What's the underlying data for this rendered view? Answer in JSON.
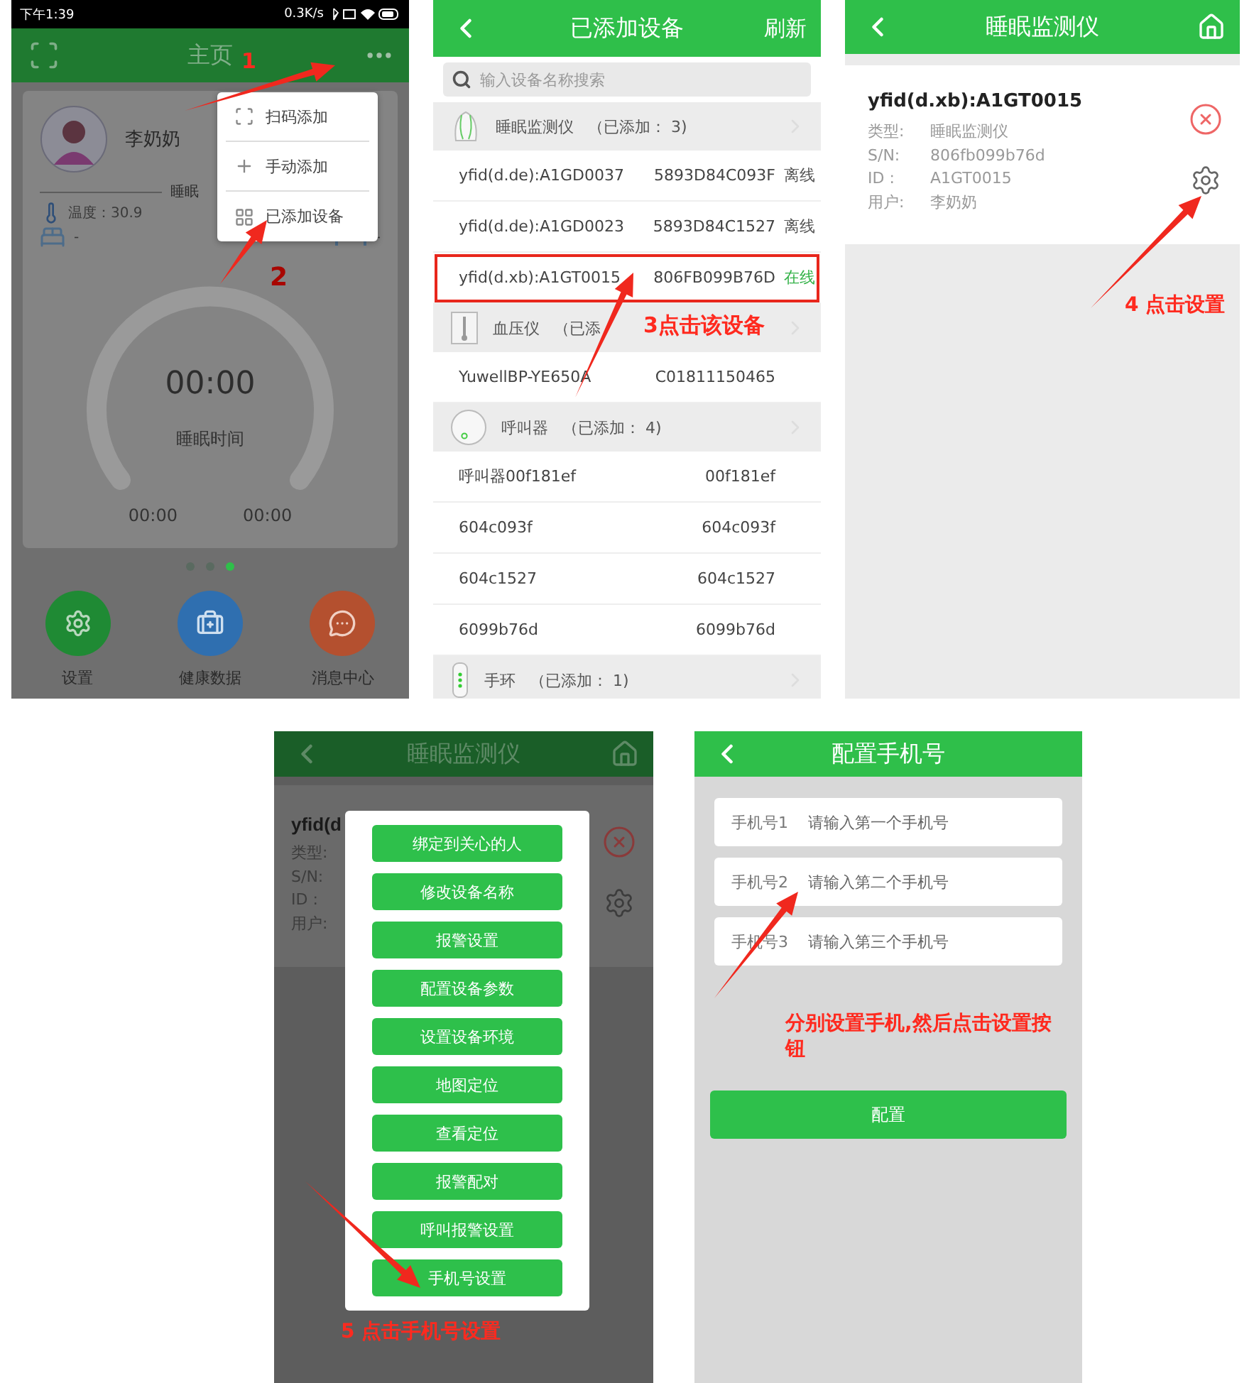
{
  "home_screen": {
    "status_bar": {
      "time": "下午1:39",
      "speed": "0.3K/s"
    },
    "title": "主页",
    "user_name": "李奶奶",
    "section_label": "睡眠",
    "temperature": "温度：30.9",
    "bed_left": "-",
    "bed_right": "-",
    "timer": "00:00",
    "timer_label": "睡眠时间",
    "start_time": "00:00",
    "end_time": "00:00",
    "pager": [
      {
        "selected": false
      },
      {
        "selected": false
      },
      {
        "selected": true
      }
    ],
    "bottom_nav": [
      {
        "label": "设置",
        "kind": "gear",
        "color": "#1f8a34"
      },
      {
        "label": "健康数据",
        "kind": "medkit",
        "color": "#2f6fb0"
      },
      {
        "label": "消息中心",
        "kind": "chat",
        "color": "#b4502f"
      }
    ],
    "menu": [
      {
        "label": "扫码添加",
        "kind": "scan"
      },
      {
        "label": "手动添加",
        "kind": "plus"
      },
      {
        "label": "已添加设备",
        "kind": "grid"
      }
    ],
    "annotations": [
      "1",
      "2"
    ]
  },
  "device_list_screen": {
    "title": "已添加设备",
    "action": "刷新",
    "search": {
      "placeholder": "输入设备名称搜索"
    },
    "groups": [
      {
        "name": "睡眠监测仪",
        "count": "（已添加： 3)",
        "kind": "sleep",
        "devices": [
          {
            "name": "yfid(d.de):A1GD0037",
            "serial": "5893D84C093F",
            "status": "离线",
            "online": false,
            "selected": false
          },
          {
            "name": "yfid(d.de):A1GD0023",
            "serial": "5893D84C1527",
            "status": "离线",
            "online": false,
            "selected": false
          },
          {
            "name": "yfid(d.xb):A1GT0015",
            "serial": "806FB099B76D",
            "status": "在线",
            "online": true,
            "selected": true
          }
        ]
      },
      {
        "name": "血压仪",
        "count": "（已添",
        "kind": "pressure",
        "devices": [
          {
            "name": "YuwellBP-YE650A",
            "serial": "C01811150465",
            "selected": false
          }
        ]
      },
      {
        "name": "呼叫器",
        "count": "（已添加： 4)",
        "kind": "caller",
        "devices": [
          {
            "name": "呼叫器00f181ef",
            "serial": "00f181ef",
            "selected": false
          },
          {
            "name": "604c093f",
            "serial": "604c093f",
            "selected": false
          },
          {
            "name": "604c1527",
            "serial": "604c1527",
            "selected": false
          },
          {
            "name": "6099b76d",
            "serial": "6099b76d",
            "selected": false
          }
        ]
      },
      {
        "name": "手环",
        "count": "（已添加： 1)",
        "kind": "band"
      }
    ],
    "annotation": "3点击该设备"
  },
  "device_detail_screen": {
    "title": "睡眠监测仪",
    "device_name": "yfid(d.xb):A1GT0015",
    "fields": [
      {
        "label": "类型:",
        "value": "睡眠监测仪"
      },
      {
        "label": "S/N:",
        "value": "806fb099b76d"
      },
      {
        "label": "ID :",
        "value": "A1GT0015"
      },
      {
        "label": "用户:",
        "value": "李奶奶"
      }
    ],
    "annotation": "4 点击设置"
  },
  "actions_screen": {
    "title": "睡眠监测仪",
    "device_name": "yfid(d",
    "field_labels": [
      "类型:",
      "S/N:",
      "ID :",
      "用户:"
    ],
    "actions": [
      "绑定到关心的人",
      "修改设备名称",
      "报警设置",
      "配置设备参数",
      "设置设备环境",
      "地图定位",
      "查看定位",
      "报警配对",
      "呼叫报警设置",
      "手机号设置"
    ],
    "annotation": "5 点击手机号设置"
  },
  "phone_config_screen": {
    "title": "配置手机号",
    "fields": [
      {
        "label": "手机号1",
        "placeholder": "请输入第一个手机号"
      },
      {
        "label": "手机号2",
        "placeholder": "请输入第二个手机号"
      },
      {
        "label": "手机号3",
        "placeholder": "请输入第三个手机号"
      }
    ],
    "button": "配置",
    "annotation": "分别设置手机,然后点击设置按钮"
  }
}
